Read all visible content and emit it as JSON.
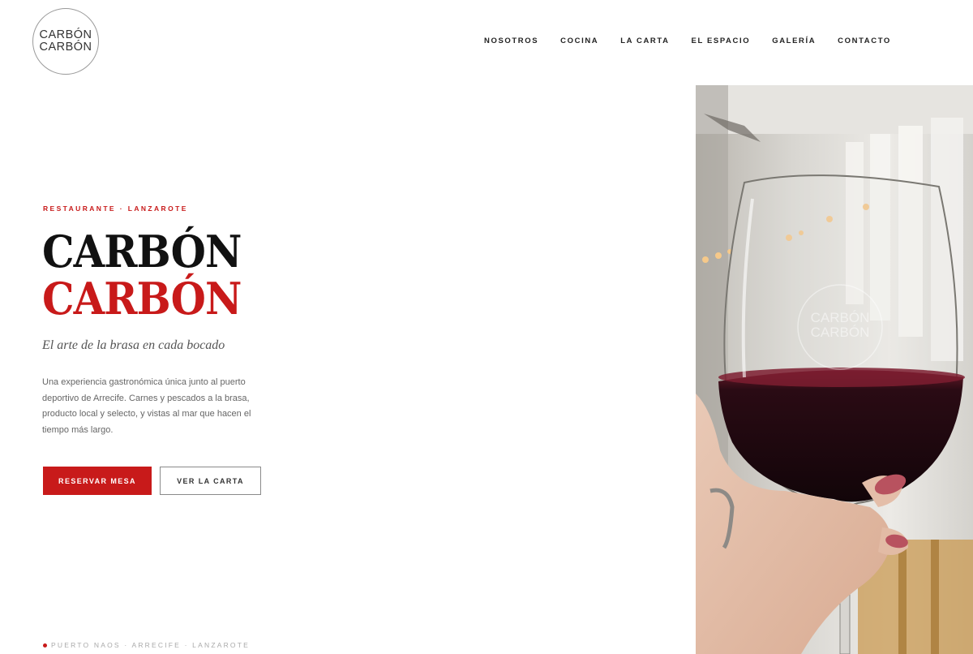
{
  "logo": {
    "line1": "CARBÓN",
    "line2": "CARBÓN"
  },
  "nav": [
    {
      "label": "NOSOTROS"
    },
    {
      "label": "COCINA"
    },
    {
      "label": "LA CARTA"
    },
    {
      "label": "EL ESPACIO"
    },
    {
      "label": "GALERÍA"
    },
    {
      "label": "CONTACTO"
    }
  ],
  "hero": {
    "eyebrow": "RESTAURANTE · LANZAROTE",
    "title_line1": "CARBÓN",
    "title_line2": "CARBÓN",
    "tagline": "El arte de la brasa en cada bocado",
    "description": "Una experiencia gastronómica única junto al puerto deportivo de Arrecife. Carnes y pescados a la brasa, producto local y selecto, y vistas al mar que hacen el tiempo más largo.",
    "primary_button": "RESERVAR MESA",
    "secondary_button": "VER LA CARTA",
    "location": "PUERTO NAOS · ARRECIFE · LANZAROTE"
  },
  "photo": {
    "glass_print_line1": "CARBÓN",
    "glass_print_line2": "CARBÓN"
  },
  "colors": {
    "accent": "#c81a1a",
    "text": "#111111",
    "muted": "#666666"
  }
}
